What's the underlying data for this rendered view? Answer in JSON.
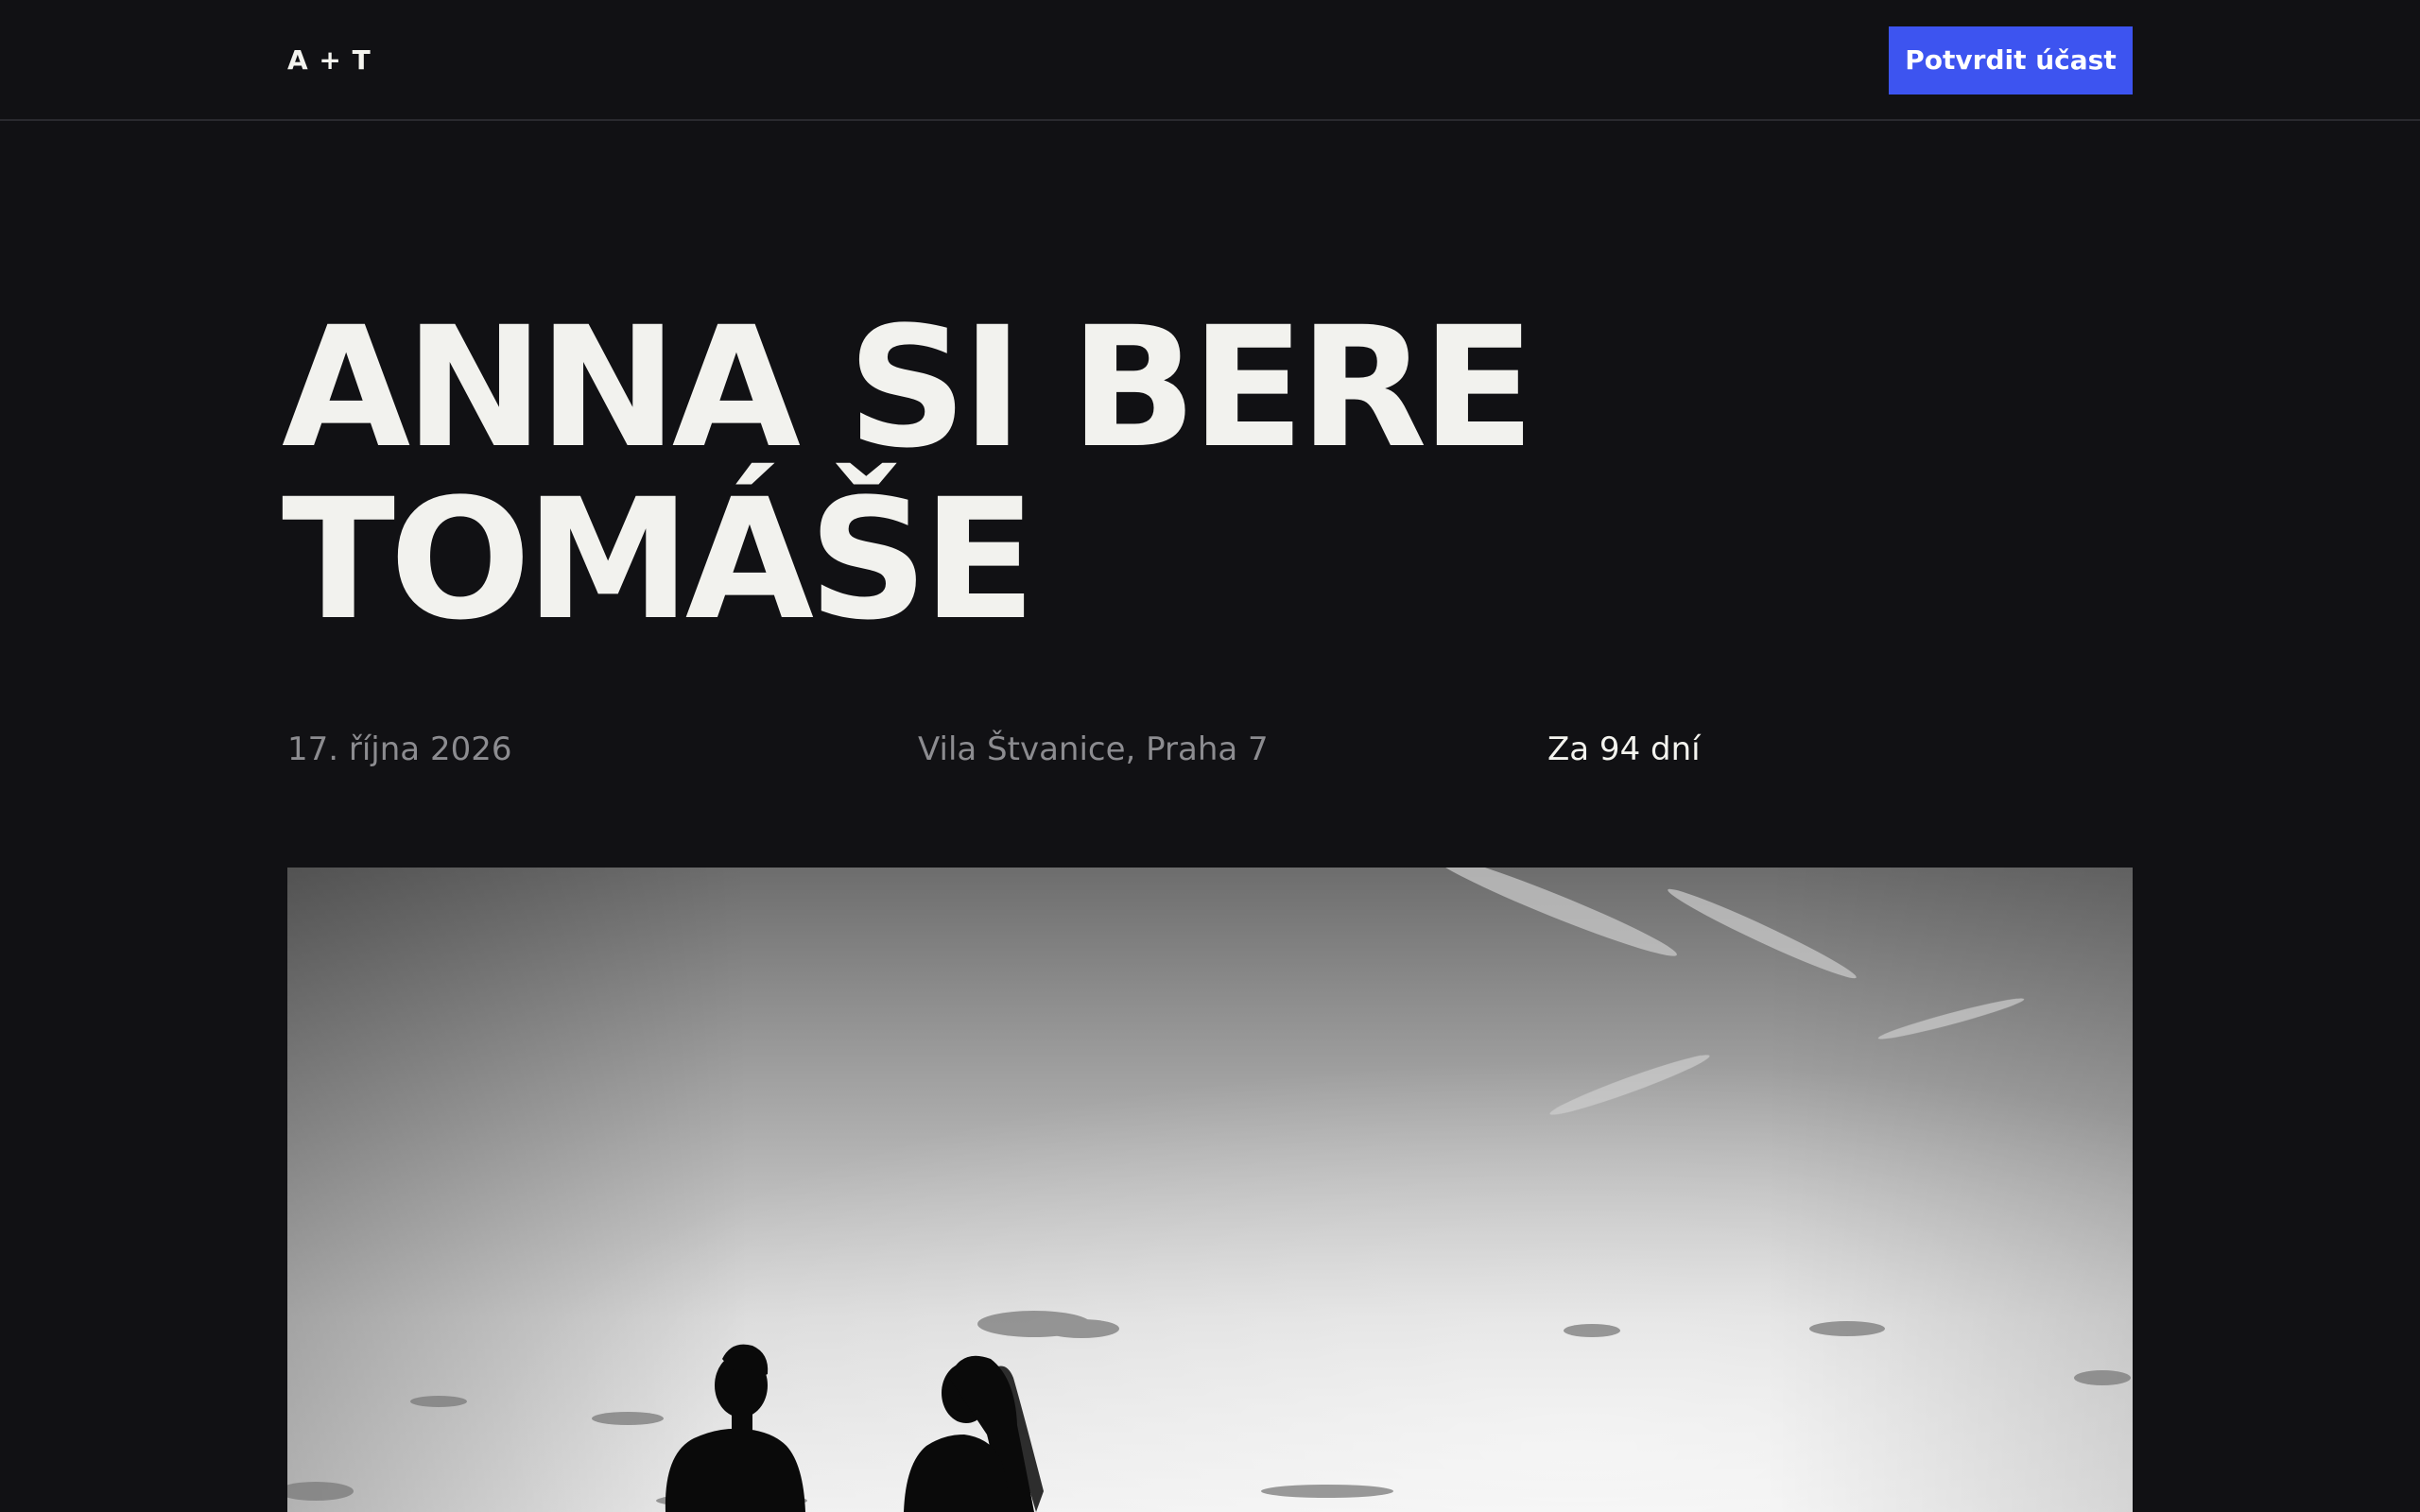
{
  "header": {
    "logo": "A + T",
    "rsvp_label": "Potvrdit účast"
  },
  "hero": {
    "headline_line1": "ANNA SI BERE",
    "headline_line2": "TOMÁŠE",
    "date": "17. října 2026",
    "venue": "Vila Štvanice, Praha 7",
    "countdown": "Za 94 dní"
  },
  "colors": {
    "background": "#111114",
    "accent": "#3d54f0",
    "text_primary": "#f2f2ee",
    "text_muted": "#8c8c90"
  }
}
